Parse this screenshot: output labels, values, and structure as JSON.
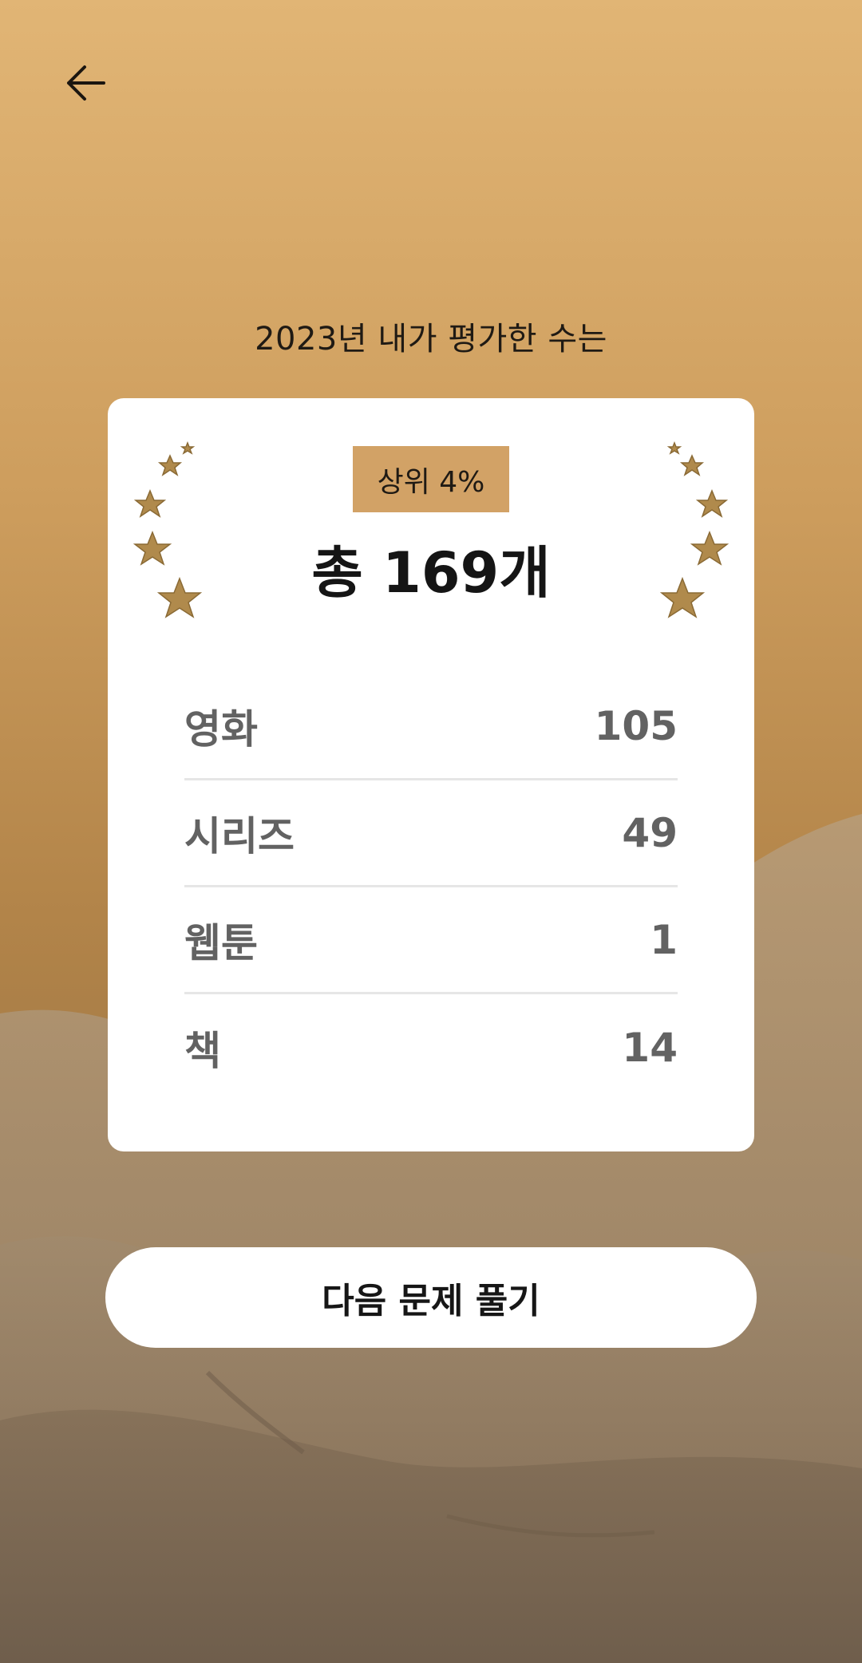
{
  "header": {
    "back_icon": "arrow-left-icon"
  },
  "headline": "2023년 내가 평가한 수는",
  "card": {
    "rank_badge": "상위 4%",
    "total": "총 169개",
    "decoration_icon": "star-laurel-icon",
    "stats": [
      {
        "label": "영화",
        "value": "105"
      },
      {
        "label": "시리즈",
        "value": "49"
      },
      {
        "label": "웹툰",
        "value": "1"
      },
      {
        "label": "책",
        "value": "14"
      }
    ]
  },
  "next_button": {
    "label": "다음 문제 풀기"
  },
  "colors": {
    "background_top": "#e1b575",
    "background_bottom": "#8c7058",
    "badge": "#d2a266",
    "star_gold": "#b08a4c"
  }
}
